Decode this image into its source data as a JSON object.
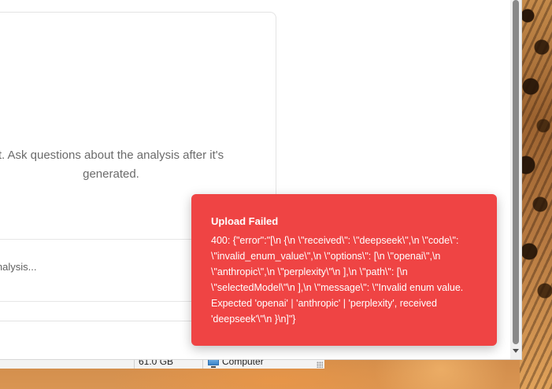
{
  "chat_panel": {
    "empty_message": "t. Ask questions about the analysis after it's generated.",
    "input_placeholder": " analysis..."
  },
  "toast": {
    "title": "Upload Failed",
    "message": "400: {\"error\":\"[\\n {\\n \\\"received\\\": \\\"deepseek\\\",\\n \\\"code\\\": \\\"invalid_enum_value\\\",\\n \\\"options\\\": [\\n \\\"openai\\\",\\n \\\"anthropic\\\",\\n \\\"perplexity\\\"\\n ],\\n \\\"path\\\": [\\n \\\"selectedModel\\\"\\n ],\\n \\\"message\\\": \\\"Invalid enum value. Expected 'openai' | 'anthropic' | 'perplexity', received 'deepseek'\\\"\\n }\\n]\"}",
    "color": "#ef4444"
  },
  "background_window": {
    "size_value": "61.0 GB",
    "location_label": "Computer"
  },
  "icons": {
    "computer": "computer-icon",
    "scroll_down": "chevron-down-icon"
  }
}
